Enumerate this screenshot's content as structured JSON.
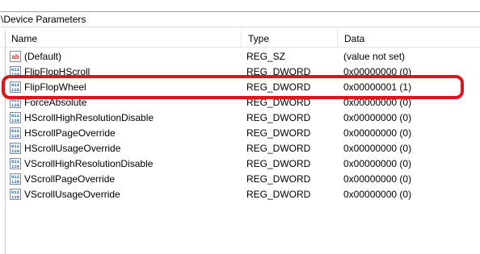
{
  "path": "\\Device Parameters",
  "columns": {
    "name": "Name",
    "type": "Type",
    "data": "Data"
  },
  "rows": [
    {
      "icon": "string-value-icon",
      "name": "(Default)",
      "type": "REG_SZ",
      "data": "(value not set)"
    },
    {
      "icon": "binary-value-icon",
      "name": "FlipFlopHScroll",
      "type": "REG_DWORD",
      "data": "0x00000000 (0)"
    },
    {
      "icon": "binary-value-icon",
      "name": "FlipFlopWheel",
      "type": "REG_DWORD",
      "data": "0x00000001 (1)"
    },
    {
      "icon": "binary-value-icon",
      "name": "ForceAbsolute",
      "type": "REG_DWORD",
      "data": "0x00000000 (0)"
    },
    {
      "icon": "binary-value-icon",
      "name": "HScrollHighResolutionDisable",
      "type": "REG_DWORD",
      "data": "0x00000000 (0)"
    },
    {
      "icon": "binary-value-icon",
      "name": "HScrollPageOverride",
      "type": "REG_DWORD",
      "data": "0x00000000 (0)"
    },
    {
      "icon": "binary-value-icon",
      "name": "HScrollUsageOverride",
      "type": "REG_DWORD",
      "data": "0x00000000 (0)"
    },
    {
      "icon": "binary-value-icon",
      "name": "VScrollHighResolutionDisable",
      "type": "REG_DWORD",
      "data": "0x00000000 (0)"
    },
    {
      "icon": "binary-value-icon",
      "name": "VScrollPageOverride",
      "type": "REG_DWORD",
      "data": "0x00000000 (0)"
    },
    {
      "icon": "binary-value-icon",
      "name": "VScrollUsageOverride",
      "type": "REG_DWORD",
      "data": "0x00000000 (0)"
    }
  ],
  "colors": {
    "highlight": "#e0141c",
    "binary_icon": "#1c5fb8",
    "string_icon": "#d0342c"
  }
}
